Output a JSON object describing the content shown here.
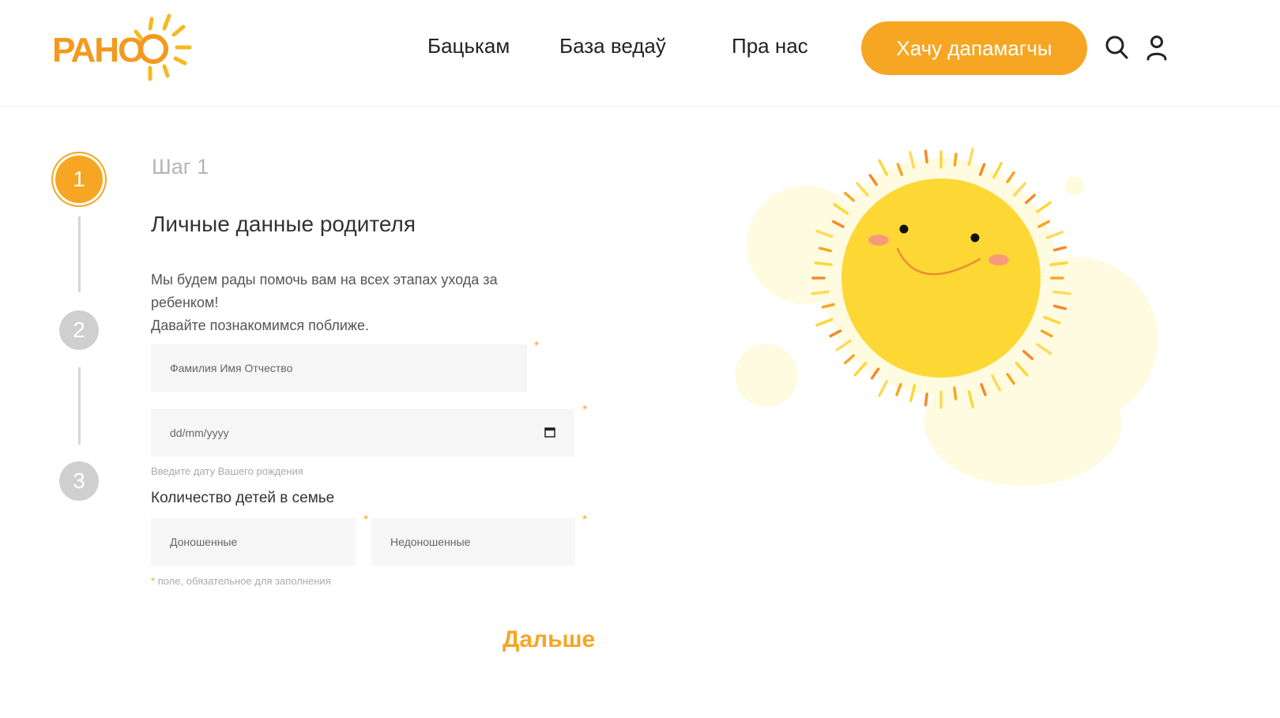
{
  "header": {
    "logo_text": "РАНО",
    "nav": [
      {
        "label": "Бацькам"
      },
      {
        "label": "База ведаў"
      },
      {
        "label": "Пра нас"
      }
    ],
    "cta_label": "Хачу дапамагчы",
    "icons": {
      "search": "search-icon",
      "profile": "user-icon"
    }
  },
  "steps": [
    {
      "number": "1",
      "state": "active"
    },
    {
      "number": "2",
      "state": "inactive"
    },
    {
      "number": "3",
      "state": "inactive"
    }
  ],
  "form": {
    "step_label": "Шаг 1",
    "title": "Личные данные родителя",
    "intro_line1": "Мы будем рады помочь вам на всех этапах ухода за ребенком!",
    "intro_line2": "Давайте познакомимся поближе.",
    "full_name_placeholder": "Фамилия Имя Отчество",
    "birthdate_placeholder": "dd/mm/yyyy",
    "birthdate_hint": "Введите дату Вашего рождения",
    "children_title": "Количество детей в семье",
    "full_term_placeholder": "Доношенные",
    "premature_placeholder": "Недоношенные",
    "required_marker": "*",
    "required_note": "поле, обязательное для заполнения",
    "next_label": "Дальше"
  },
  "colors": {
    "accent": "#f6a623",
    "sun": "#fdd835",
    "inactive_step": "#cfcfcf",
    "field_bg": "#f6f6f6"
  }
}
